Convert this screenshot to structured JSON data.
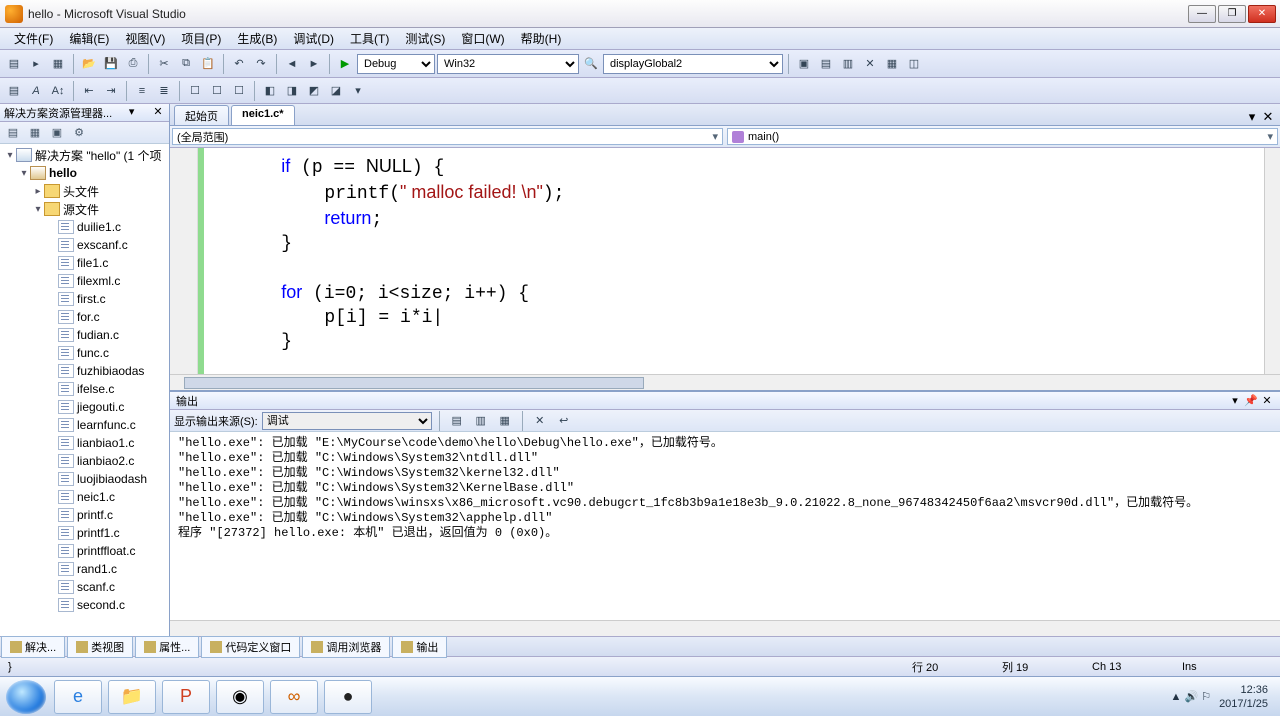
{
  "title": "hello - Microsoft Visual Studio",
  "menu": [
    "文件(F)",
    "编辑(E)",
    "视图(V)",
    "项目(P)",
    "生成(B)",
    "调试(D)",
    "工具(T)",
    "测试(S)",
    "窗口(W)",
    "帮助(H)"
  ],
  "config": {
    "debug": "Debug",
    "platform": "Win32",
    "find": "displayGlobal2"
  },
  "solx": {
    "header": "解决方案资源管理器...",
    "solution": "解决方案 \"hello\" (1 个项",
    "project": "hello",
    "folders": {
      "headers": "头文件",
      "sources": "源文件"
    },
    "files": [
      "duilie1.c",
      "exscanf.c",
      "file1.c",
      "filexml.c",
      "first.c",
      "for.c",
      "fudian.c",
      "func.c",
      "fuzhibiaodas",
      "ifelse.c",
      "jiegouti.c",
      "learnfunc.c",
      "lianbiao1.c",
      "lianbiao2.c",
      "luojibiaodash",
      "neic1.c",
      "printf.c",
      "printf1.c",
      "printffloat.c",
      "rand1.c",
      "scanf.c",
      "second.c"
    ]
  },
  "tabs": {
    "start": "起始页",
    "active": "neic1.c*"
  },
  "nav": {
    "scope": "(全局范围)",
    "func": "main()"
  },
  "code_lines": [
    {
      "indent": 1,
      "tokens": [
        {
          "t": "if",
          "c": "kw"
        },
        {
          "t": " (p == "
        },
        {
          "t": "NULL",
          "c": "const"
        },
        {
          "t": ") {"
        }
      ]
    },
    {
      "indent": 2,
      "tokens": [
        {
          "t": "printf("
        },
        {
          "t": "\" malloc failed! \\n\"",
          "c": "str"
        },
        {
          "t": ");"
        }
      ]
    },
    {
      "indent": 2,
      "tokens": [
        {
          "t": "return",
          "c": "kw"
        },
        {
          "t": ";"
        }
      ]
    },
    {
      "indent": 1,
      "tokens": [
        {
          "t": "}"
        }
      ]
    },
    {
      "indent": 0,
      "tokens": [
        {
          "t": ""
        }
      ]
    },
    {
      "indent": 1,
      "tokens": [
        {
          "t": "for",
          "c": "kw"
        },
        {
          "t": " (i=0; i<size; i++) {"
        }
      ]
    },
    {
      "indent": 2,
      "tokens": [
        {
          "t": "p[i] = i*i|"
        }
      ]
    },
    {
      "indent": 1,
      "tokens": [
        {
          "t": "}"
        }
      ]
    }
  ],
  "output": {
    "title": "输出",
    "src_label": "显示输出来源(S):",
    "src_value": "调试",
    "lines": [
      "\"hello.exe\": 已加载 \"E:\\MyCourse\\code\\demo\\hello\\Debug\\hello.exe\"，已加载符号。",
      "\"hello.exe\": 已加载 \"C:\\Windows\\System32\\ntdll.dll\"",
      "\"hello.exe\": 已加载 \"C:\\Windows\\System32\\kernel32.dll\"",
      "\"hello.exe\": 已加载 \"C:\\Windows\\System32\\KernelBase.dll\"",
      "\"hello.exe\": 已加载 \"C:\\Windows\\winsxs\\x86_microsoft.vc90.debugcrt_1fc8b3b9a1e18e3b_9.0.21022.8_none_96748342450f6aa2\\msvcr90d.dll\"，已加载符号。",
      "\"hello.exe\": 已加载 \"C:\\Windows\\System32\\apphelp.dll\"",
      "程序 \"[27372] hello.exe: 本机\" 已退出，返回值为 0 (0x0)。"
    ]
  },
  "btabs": [
    "解决...",
    "类视图",
    "属性...",
    "代码定义窗口",
    "调用浏览器",
    "输出"
  ],
  "status": {
    "line": "行 20",
    "col": "列 19",
    "ch": "Ch 13",
    "mode": "Ins"
  },
  "clock": {
    "time": "12:36",
    "date": "2017/1/25"
  }
}
